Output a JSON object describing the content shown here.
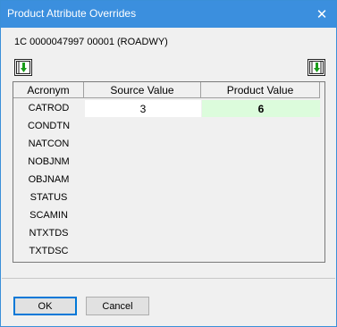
{
  "window": {
    "title": "Product Attribute Overrides"
  },
  "record": {
    "id": "1C 0000047997 00001 (ROADWY)"
  },
  "grid": {
    "headers": [
      "Acronym",
      "Source Value",
      "Product Value"
    ],
    "rows": [
      {
        "acronym": "CATROD",
        "source": "3",
        "product": "6"
      },
      {
        "acronym": "CONDTN"
      },
      {
        "acronym": "NATCON"
      },
      {
        "acronym": "NOBJNM"
      },
      {
        "acronym": "OBJNAM"
      },
      {
        "acronym": "STATUS"
      },
      {
        "acronym": "SCAMIN"
      },
      {
        "acronym": "NTXTDS"
      },
      {
        "acronym": "TXTDSC"
      }
    ]
  },
  "buttons": {
    "ok": "OK",
    "cancel": "Cancel"
  },
  "icons": {
    "close": "close-icon",
    "left": "download-left-icon",
    "right": "download-right-icon"
  },
  "colors": {
    "titlebar": "#3b8fde",
    "product_cell": "#dcfcdc",
    "icon_green": "#1a9c1a"
  }
}
